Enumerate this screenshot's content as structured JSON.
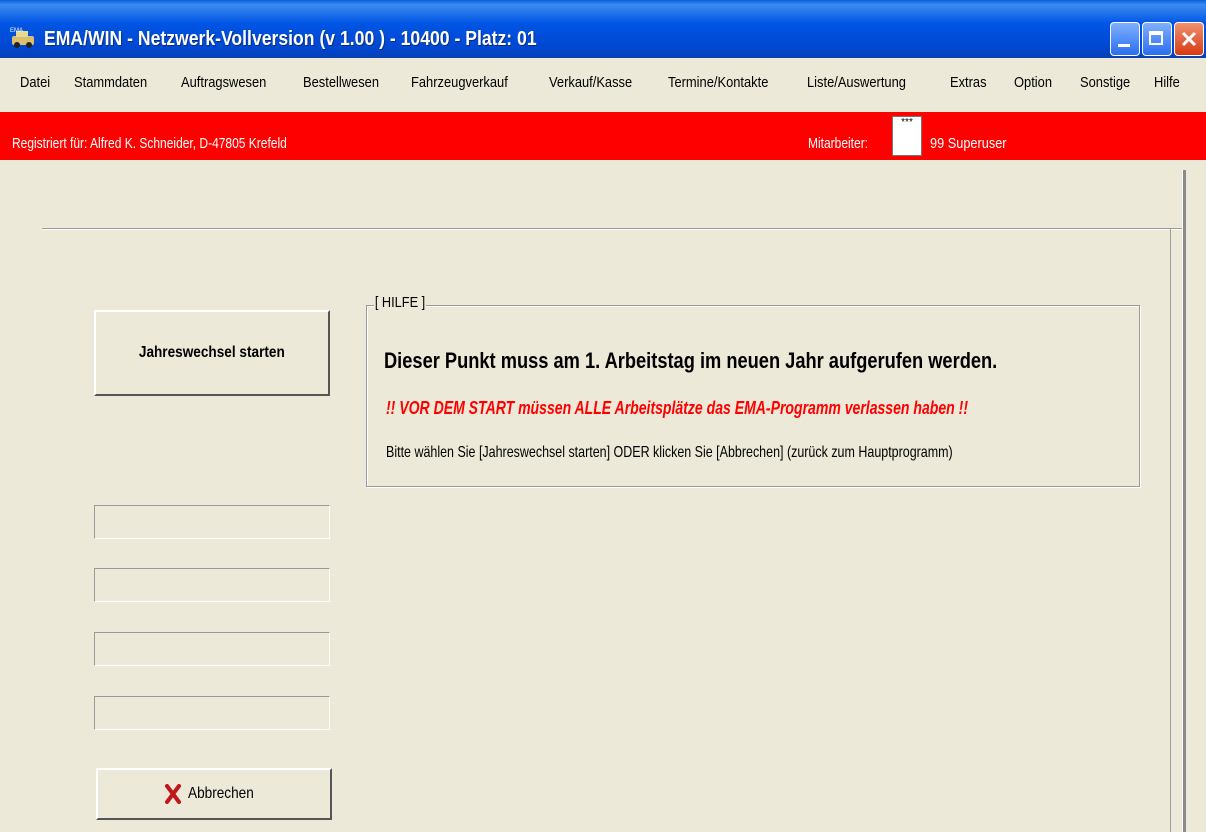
{
  "window": {
    "title": "EMA/WIN - Netzwerk-Vollversion (v  1.00  ) - 10400 - Platz: 01",
    "icon": "app-logo-icon"
  },
  "menu": [
    {
      "label": "Datei"
    },
    {
      "label": "Stammdaten"
    },
    {
      "label": "Auftragswesen"
    },
    {
      "label": "Bestellwesen"
    },
    {
      "label": "Fahrzeugverkauf"
    },
    {
      "label": "Verkauf/Kasse"
    },
    {
      "label": "Termine/Kontakte"
    },
    {
      "label": "Liste/Auswertung"
    },
    {
      "label": "Extras"
    },
    {
      "label": "Option"
    },
    {
      "label": "Sonstige"
    },
    {
      "label": "Hilfe"
    }
  ],
  "regbar": {
    "registered": "Registriert für: Alfred K. Schneider, D-47805 Krefeld",
    "employee_label": "Mitarbeiter:",
    "employee_code": "***",
    "employee_name": "99  Superuser",
    "color": "#ff0000"
  },
  "actions": {
    "start_label": "Jahreswechsel starten",
    "cancel_label": "Abbrechen",
    "cancel_icon": "red-x-icon"
  },
  "help": {
    "legend": "[ HILFE ]",
    "line1": "Dieser Punkt muss am 1. Arbeitstag im neuen Jahr aufgerufen werden.",
    "line2": "!! VOR DEM START müssen ALLE Arbeitsplätze das EMA-Programm verlassen haben !!",
    "line3": "Bitte wählen Sie [Jahreswechsel starten]     ODER klicken Sie [Abbrechen] (zurück zum Hauptprogramm)",
    "warning_color": "#ff0000"
  },
  "status_fields": [
    "",
    "",
    "",
    ""
  ]
}
